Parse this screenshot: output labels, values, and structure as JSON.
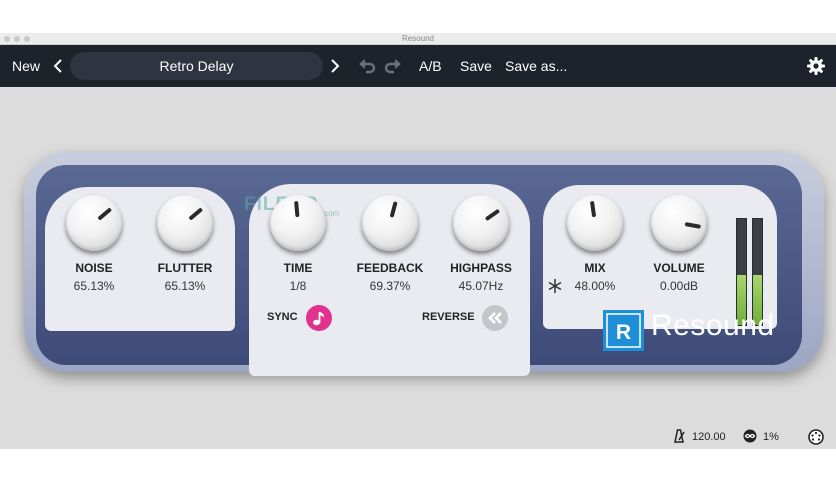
{
  "window": {
    "title": "Resound"
  },
  "toolbar": {
    "new_label": "New",
    "preset_name": "Retro Delay",
    "ab_label": "A/B",
    "save_label": "Save",
    "save_as_label": "Save as..."
  },
  "plugin": {
    "brand_name": "Resound",
    "brand_logo_letter": "R",
    "brand_color": "#1e8fd6",
    "knobs": [
      {
        "label": "NOISE",
        "value": "65.13%"
      },
      {
        "label": "FLUTTER",
        "value": "65.13%"
      },
      {
        "label": "TIME",
        "value": "1/8"
      },
      {
        "label": "FEEDBACK",
        "value": "69.37%"
      },
      {
        "label": "HIGHPASS",
        "value": "45.07Hz"
      },
      {
        "label": "MIX",
        "value": "48.00%"
      },
      {
        "label": "VOLUME",
        "value": "0.00dB"
      }
    ],
    "sync_label": "SYNC",
    "sync_color": "#e0338f",
    "reverse_label": "REVERSE",
    "meter_levels": [
      0.47,
      0.47
    ],
    "watermark_text": "FILECR",
    "watermark_sub": ".com"
  },
  "status": {
    "tempo": "120.00",
    "cpu": "1%"
  }
}
